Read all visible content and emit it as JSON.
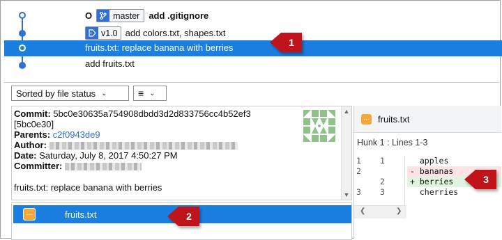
{
  "commits": [
    {
      "ref_head": "O",
      "branch": "master",
      "message": "add .gitignore"
    },
    {
      "tag": "v1.0",
      "message": "add colors.txt, shapes.txt"
    },
    {
      "message": "fruits.txt: replace banana with berries"
    },
    {
      "message": "add fruits.txt"
    }
  ],
  "callouts": [
    "1",
    "2",
    "3"
  ],
  "toolbar": {
    "sort_label": "Sorted by file status"
  },
  "details": {
    "commit_label": "Commit:",
    "commit_hash": "5bc0e30635a754908dbdd3d2d833756cc4b52ef3",
    "commit_short": "[5bc0e30]",
    "parents_label": "Parents:",
    "parents_value": "c2f0943de9",
    "author_label": "Author:",
    "date_label": "Date:",
    "date_value": "Saturday, July 8, 2017 4:50:27 PM",
    "committer_label": "Committer:",
    "message": "fruits.txt: replace banana with berries"
  },
  "files": [
    {
      "name": "fruits.txt"
    }
  ],
  "diff": {
    "file_name": "fruits.txt",
    "hunk": "Hunk 1 : Lines 1-3",
    "lines": [
      {
        "old": "1",
        "new": "1",
        "text": "  apples"
      },
      {
        "old": "2",
        "new": "",
        "text": "- bananas"
      },
      {
        "old": "",
        "new": "2",
        "text": "+ berries"
      },
      {
        "old": "3",
        "new": "3",
        "text": "  cherries"
      }
    ]
  },
  "colors": {
    "accent": "#1a7fe0",
    "callout": "#c0141c",
    "graph": "#2f6fd6"
  }
}
